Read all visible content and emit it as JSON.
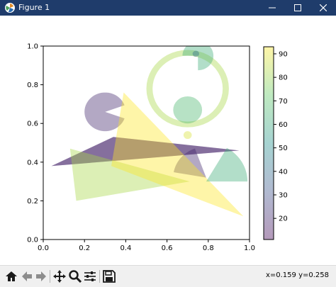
{
  "window": {
    "title": "Figure 1",
    "icon": "matplotlib-logo-icon",
    "titlebar_color": "#1f3c6b",
    "buttons": [
      "minimize-icon",
      "maximize-icon",
      "close-icon"
    ]
  },
  "toolbar": {
    "buttons": [
      "home-icon",
      "back-arrow-icon",
      "forward-arrow-icon",
      "pan-icon",
      "zoom-icon",
      "configure-subplots-icon",
      "save-icon"
    ],
    "coords": "x=0.159 y=0.258"
  },
  "chart_data": {
    "type": "scatter",
    "description_free": true,
    "xlim": [
      0,
      1
    ],
    "ylim": [
      0,
      1
    ],
    "xticks": [
      "0.0",
      "0.2",
      "0.4",
      "0.6",
      "0.8",
      "1.0"
    ],
    "yticks": [
      "0.0",
      "0.2",
      "0.4",
      "0.6",
      "0.8",
      "1.0"
    ],
    "grid": false,
    "colorbar": {
      "colormap": "viridis",
      "range": [
        11,
        93
      ],
      "ticks": [
        "20",
        "30",
        "40",
        "50",
        "60",
        "70",
        "80",
        "90"
      ],
      "tick_values": [
        20,
        30,
        40,
        50,
        60,
        70,
        80,
        90
      ]
    },
    "alpha": 0.4,
    "patches": [
      {
        "kind": "wedge",
        "center": [
          0.3,
          0.66
        ],
        "r": 0.1,
        "theta1": 20,
        "theta2": 340,
        "value": 20
      },
      {
        "kind": "polygon",
        "points": [
          [
            0.04,
            0.38
          ],
          [
            0.34,
            0.53
          ],
          [
            0.95,
            0.46
          ]
        ],
        "value": 18
      },
      {
        "kind": "polygon",
        "points": [
          [
            0.04,
            0.38
          ],
          [
            0.95,
            0.46
          ],
          [
            0.34,
            0.53
          ],
          [
            0.34,
            0.53
          ]
        ],
        "value": 18
      },
      {
        "kind": "wedge",
        "center": [
          0.79,
          0.32
        ],
        "r": 0.16,
        "theta1": 110,
        "theta2": 170,
        "value": 20
      },
      {
        "kind": "polygon",
        "points": [
          [
            0.13,
            0.47
          ],
          [
            0.16,
            0.2
          ],
          [
            0.71,
            0.3
          ]
        ],
        "value": 82
      },
      {
        "kind": "polygon",
        "points": [
          [
            0.39,
            0.76
          ],
          [
            0.33,
            0.38
          ],
          [
            0.97,
            0.12
          ]
        ],
        "value": 93
      },
      {
        "kind": "wedge",
        "center": [
          0.79,
          0.3
        ],
        "r": 0.2,
        "theta1": 0,
        "theta2": 60,
        "value": 62
      },
      {
        "kind": "ring",
        "center": [
          0.7,
          0.78
        ],
        "r": 0.2,
        "width": 0.03,
        "value": 82
      },
      {
        "kind": "circle",
        "center": [
          0.7,
          0.67
        ],
        "r": 0.07,
        "value": 66
      },
      {
        "kind": "circle",
        "center": [
          0.7,
          0.54
        ],
        "r": 0.02,
        "value": 88
      },
      {
        "kind": "wedge",
        "center": [
          0.75,
          0.95
        ],
        "r": 0.075,
        "theta1": -90,
        "theta2": 180,
        "value": 62
      },
      {
        "kind": "circle",
        "center": [
          0.74,
          0.96
        ],
        "r": 0.016,
        "value": 40
      }
    ]
  }
}
